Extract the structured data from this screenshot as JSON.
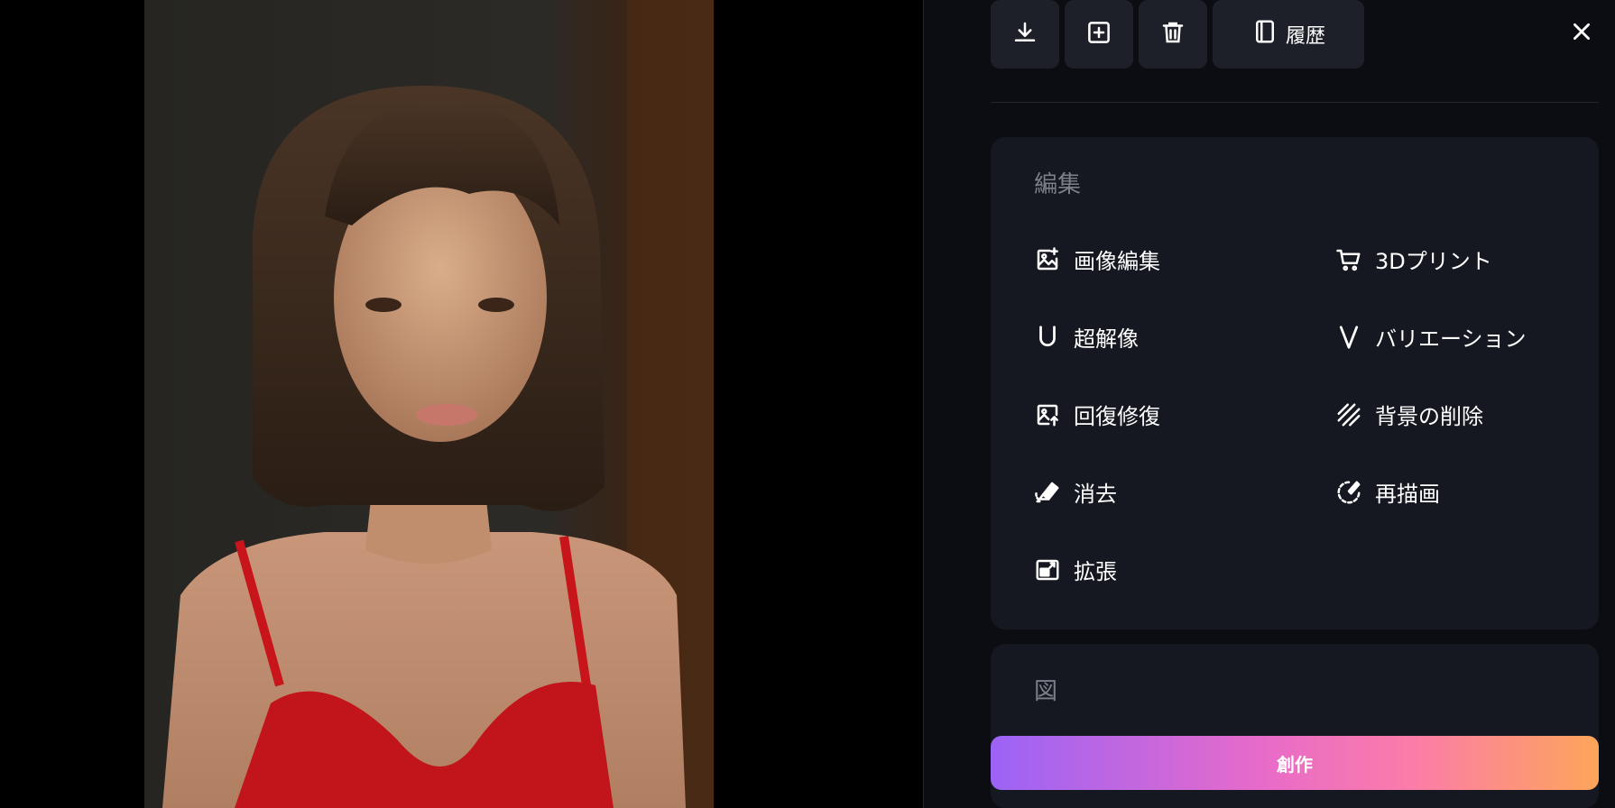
{
  "toolbar": {
    "download_icon": "download-icon",
    "add_icon": "add-square-icon",
    "delete_icon": "trash-icon",
    "history_label": "履歴",
    "history_icon": "history-icon",
    "close_icon": "close-icon"
  },
  "photo": {
    "description_icon": "portrait-photo"
  },
  "edit_section": {
    "title": "編集",
    "items": [
      {
        "label": "画像編集",
        "icon": "image-edit-icon"
      },
      {
        "label": "3Dプリント",
        "icon": "cart-icon"
      },
      {
        "label": "超解像",
        "icon": "upscale-u-icon"
      },
      {
        "label": "バリエーション",
        "icon": "variation-v-icon"
      },
      {
        "label": "回復修復",
        "icon": "restore-image-icon"
      },
      {
        "label": "背景の削除",
        "icon": "remove-background-icon"
      },
      {
        "label": "消去",
        "icon": "eraser-icon"
      },
      {
        "label": "再描画",
        "icon": "redraw-brush-icon"
      },
      {
        "label": "拡張",
        "icon": "expand-image-icon"
      }
    ]
  },
  "figure_section": {
    "title": "図"
  },
  "create_button": {
    "label": "創作"
  },
  "colors": {
    "panel_bg": "#0b0d12",
    "card_bg": "#151820",
    "button_bg": "#1d2029",
    "gradient_start": "#9b63f6",
    "gradient_end": "#fda55a"
  }
}
